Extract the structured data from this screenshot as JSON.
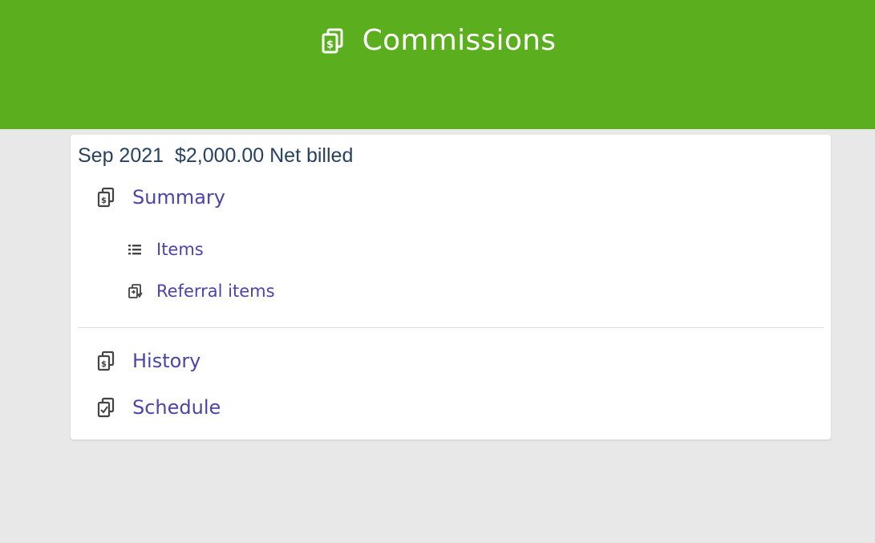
{
  "header": {
    "title": "Commissions",
    "icon": "commission-money-icon",
    "background": "#5baf1e"
  },
  "card": {
    "period": "Sep 2021",
    "amount": "$2,000.00",
    "amount_label": "Net billed"
  },
  "nav": {
    "summary": {
      "label": "Summary",
      "icon": "commission-money-icon"
    },
    "items": {
      "label": "Items",
      "icon": "list-icon"
    },
    "referral_items": {
      "label": "Referral items",
      "icon": "referral-icon"
    },
    "history": {
      "label": "History",
      "icon": "commission-money-icon"
    },
    "schedule": {
      "label": "Schedule",
      "icon": "schedule-check-icon"
    }
  },
  "colors": {
    "link": "#4a45a8",
    "text": "#27425e",
    "page_bg": "#e8e8e8"
  }
}
